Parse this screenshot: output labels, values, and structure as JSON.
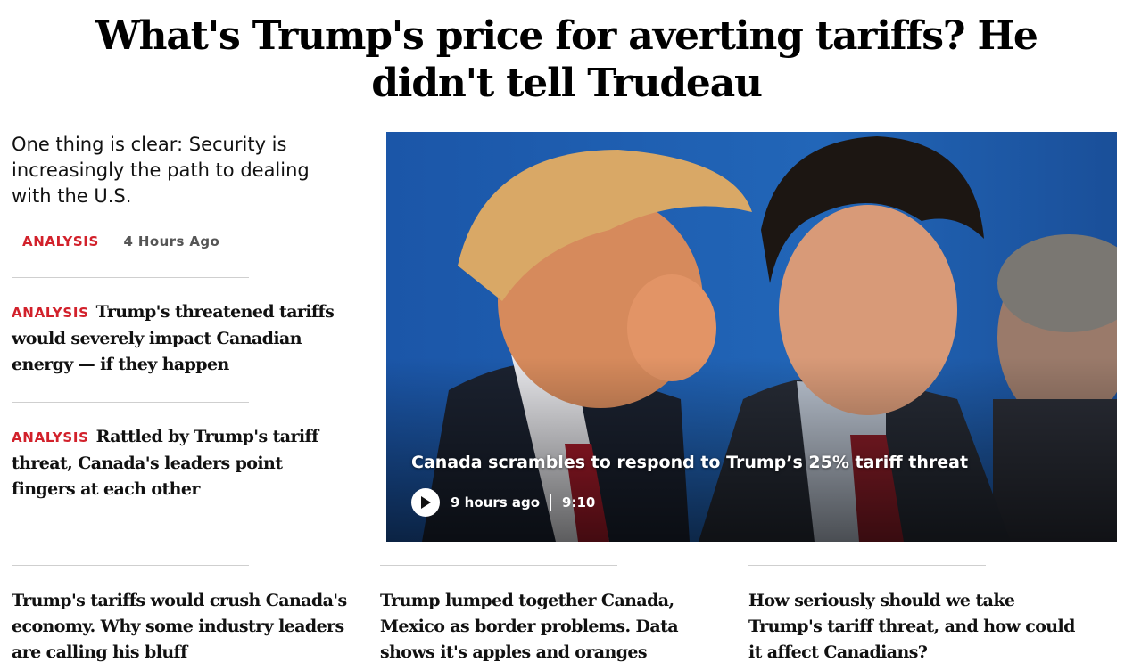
{
  "headline": "What's Trump's price for averting tariffs? He didn't tell Trudeau",
  "lead": {
    "summary": "One thing is clear: Security is increasingly the path to dealing with the U.S.",
    "tag": "ANALYSIS",
    "time": "4 Hours Ago"
  },
  "side_stories": [
    {
      "tag": "ANALYSIS",
      "title": "Trump's threatened tariffs would severely impact Canadian energy — if they happen"
    },
    {
      "tag": "ANALYSIS",
      "title": "Rattled by Trump's tariff threat, Canada's leaders point fingers at each other"
    }
  ],
  "video": {
    "caption": "Canada scrambles to respond to Trump’s 25% tariff threat",
    "time_ago": "9 hours ago",
    "duration": "9:10",
    "icon": "play-icon"
  },
  "bottom_stories": [
    {
      "title": "Trump's tariffs would crush Canada's economy. Why some industry leaders are calling his bluff"
    },
    {
      "title": "Trump lumped together Canada, Mexico as border problems. Data shows it's apples and oranges"
    },
    {
      "title": "How seriously should we take Trump's tariff threat, and how could it affect Canadians?"
    }
  ],
  "colors": {
    "accent_red": "#d2212b",
    "photo_bg_blue": "#1e5cae",
    "divider": "#cfcfcf"
  }
}
